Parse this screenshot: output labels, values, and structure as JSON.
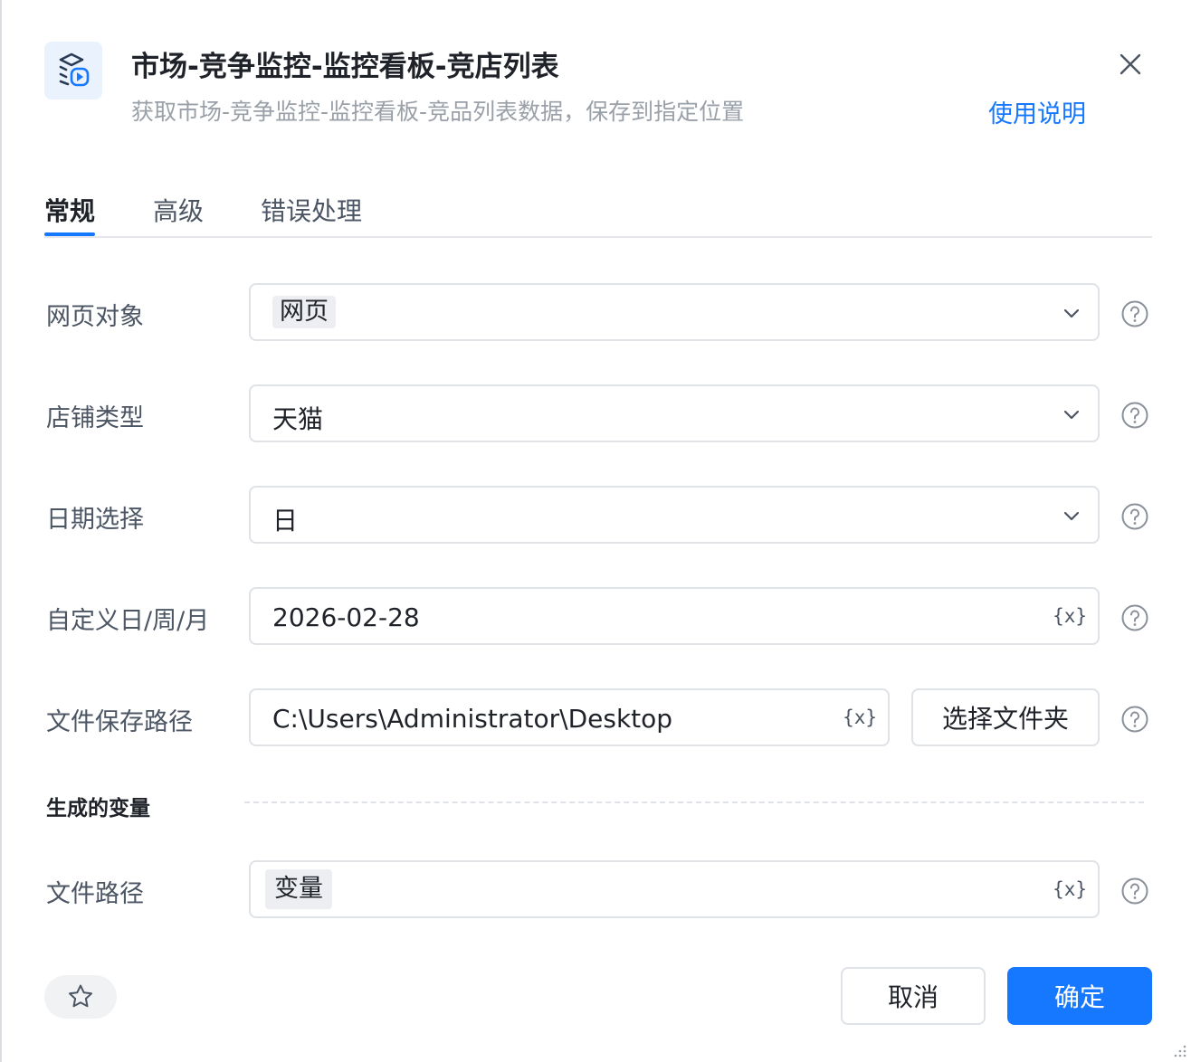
{
  "header": {
    "icon": "plugin-play-icon",
    "title": "市场-竞争监控-监控看板-竞店列表",
    "subtitle": "获取市场-竞争监控-监控看板-竞品列表数据，保存到指定位置",
    "help_link": "使用说明"
  },
  "tabs": [
    {
      "label": "常规",
      "active": true
    },
    {
      "label": "高级",
      "active": false
    },
    {
      "label": "错误处理",
      "active": false
    }
  ],
  "form": {
    "web_object": {
      "label": "网页对象",
      "value": "网页"
    },
    "shop_type": {
      "label": "店铺类型",
      "value": "天猫"
    },
    "date_select": {
      "label": "日期选择",
      "value": "日"
    },
    "custom_date": {
      "label": "自定义日/周/月",
      "value": "2026-02-28"
    },
    "save_path": {
      "label": "文件保存路径",
      "value": "C:\\Users\\Administrator\\Desktop",
      "button": "选择文件夹"
    }
  },
  "variable_button": "{x}",
  "generated": {
    "section_title": "生成的变量",
    "file_path": {
      "label": "文件路径",
      "value": "变量"
    }
  },
  "footer": {
    "cancel": "取消",
    "confirm": "确定"
  },
  "colors": {
    "accent": "#1677ff",
    "border": "#dfe2e7",
    "muted_text": "#9aa0a8"
  }
}
